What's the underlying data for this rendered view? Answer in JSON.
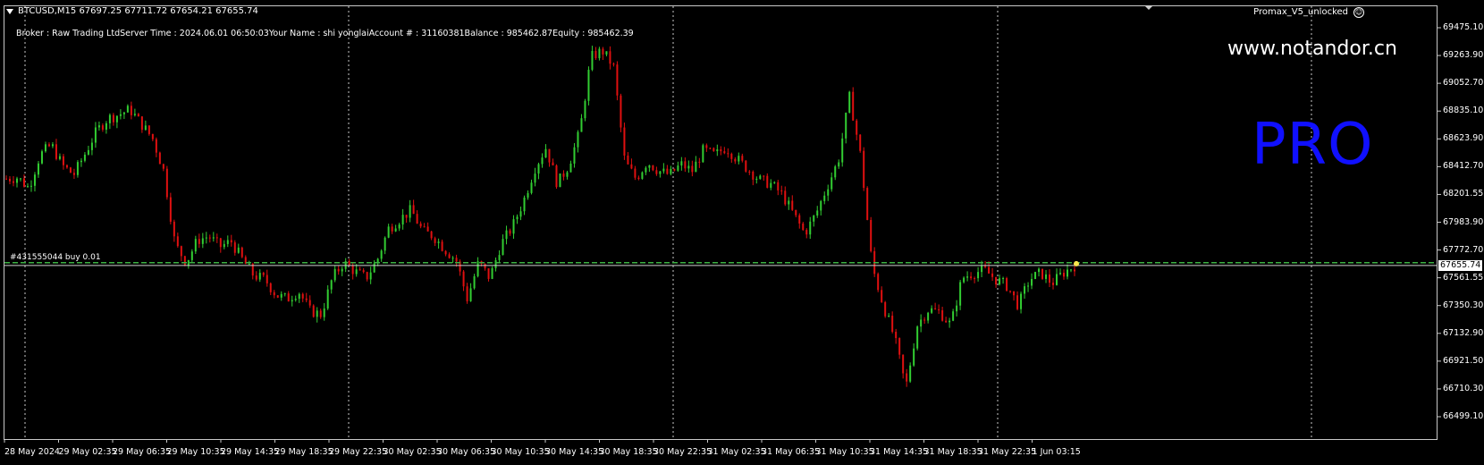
{
  "header": {
    "symbol_ohlc": "BTCUSD,M15  67697.25 67711.72 67654.21 67655.74",
    "account_info": "Broker  : Raw Trading LtdServer Time : 2024.06.01 06:50:03Your Name    : shi yonglaiAccount #  : 31160381Balance : 985462.87Equity    : 985462.39",
    "indicator_name": "Promax_V5_unlocked"
  },
  "watermarks": {
    "url": "www.notandor.cn",
    "pro": "PRO"
  },
  "order_line": {
    "label": "#431555044 buy 0.01",
    "price": 67677.9
  },
  "current_price": "67655.74",
  "price_axis": [
    "69475.10",
    "69263.90",
    "69052.70",
    "68835.10",
    "68623.90",
    "68412.70",
    "68201.55",
    "67983.90",
    "67772.70",
    "67561.55",
    "67350.30",
    "67132.90",
    "66921.50",
    "66710.30",
    "66499.10"
  ],
  "time_axis": [
    "28 May 2024",
    "29 May 02:35",
    "29 May 06:35",
    "29 May 10:35",
    "29 May 14:35",
    "29 May 18:35",
    "29 May 22:35",
    "30 May 02:35",
    "30 May 06:35",
    "30 May 10:35",
    "30 May 14:35",
    "30 May 18:35",
    "30 May 22:35",
    "31 May 02:35",
    "31 May 06:35",
    "31 May 10:35",
    "31 May 14:35",
    "31 May 18:35",
    "31 May 22:35",
    "1 Jun 03:15"
  ],
  "colors": {
    "bull": "#32cd32",
    "bear": "#e01010",
    "order_line": "#3cb043",
    "grid": "#c8c8c8",
    "pro": "#1010ff"
  },
  "chart_data": {
    "type": "candlestick",
    "symbol": "BTCUSD",
    "timeframe": "M15",
    "ylim": [
      66499.1,
      69475.1
    ],
    "close_path": [
      [
        0,
        68320
      ],
      [
        1,
        68330
      ],
      [
        2,
        68250
      ],
      [
        3,
        68500
      ],
      [
        4,
        68580
      ],
      [
        5,
        68420
      ],
      [
        6,
        68350
      ],
      [
        7,
        68510
      ],
      [
        8,
        68680
      ],
      [
        9,
        68780
      ],
      [
        10,
        68810
      ],
      [
        11,
        68850
      ],
      [
        12,
        68740
      ],
      [
        13,
        68630
      ],
      [
        14,
        68380
      ],
      [
        15,
        67820
      ],
      [
        16,
        67680
      ],
      [
        17,
        67850
      ],
      [
        18,
        67880
      ],
      [
        19,
        67800
      ],
      [
        20,
        67840
      ],
      [
        21,
        67700
      ],
      [
        22,
        67580
      ],
      [
        23,
        67550
      ],
      [
        24,
        67430
      ],
      [
        25,
        67400
      ],
      [
        26,
        67460
      ],
      [
        27,
        67310
      ],
      [
        28,
        67280
      ],
      [
        29,
        67560
      ],
      [
        30,
        67680
      ],
      [
        31,
        67610
      ],
      [
        32,
        67560
      ],
      [
        33,
        67700
      ],
      [
        34,
        67940
      ],
      [
        35,
        68010
      ],
      [
        36,
        68080
      ],
      [
        37,
        67920
      ],
      [
        38,
        67880
      ],
      [
        39,
        67780
      ],
      [
        40,
        67700
      ],
      [
        41,
        67400
      ],
      [
        42,
        67680
      ],
      [
        43,
        67560
      ],
      [
        44,
        67820
      ],
      [
        45,
        67950
      ],
      [
        46,
        68150
      ],
      [
        47,
        68400
      ],
      [
        48,
        68560
      ],
      [
        49,
        68280
      ],
      [
        50,
        68420
      ],
      [
        51,
        68680
      ],
      [
        52,
        69250
      ],
      [
        53,
        69300
      ],
      [
        54,
        69180
      ],
      [
        55,
        68450
      ],
      [
        56,
        68320
      ],
      [
        57,
        68450
      ],
      [
        58,
        68380
      ],
      [
        59,
        68350
      ],
      [
        60,
        68430
      ],
      [
        61,
        68380
      ],
      [
        62,
        68540
      ],
      [
        63,
        68500
      ],
      [
        64,
        68560
      ],
      [
        65,
        68470
      ],
      [
        66,
        68390
      ],
      [
        67,
        68310
      ],
      [
        68,
        68280
      ],
      [
        69,
        68200
      ],
      [
        70,
        68050
      ],
      [
        71,
        67900
      ],
      [
        72,
        68050
      ],
      [
        73,
        68260
      ],
      [
        74,
        68460
      ],
      [
        75,
        68950
      ],
      [
        76,
        68480
      ],
      [
        77,
        67650
      ],
      [
        78,
        67350
      ],
      [
        79,
        67100
      ],
      [
        80,
        66720
      ],
      [
        81,
        67200
      ],
      [
        82,
        67320
      ],
      [
        83,
        67300
      ],
      [
        84,
        67200
      ],
      [
        85,
        67560
      ],
      [
        86,
        67600
      ],
      [
        87,
        67620
      ],
      [
        88,
        67550
      ],
      [
        89,
        67500
      ],
      [
        90,
        67350
      ],
      [
        91,
        67550
      ],
      [
        92,
        67600
      ],
      [
        93,
        67520
      ],
      [
        94,
        67600
      ],
      [
        95,
        67655
      ]
    ]
  }
}
